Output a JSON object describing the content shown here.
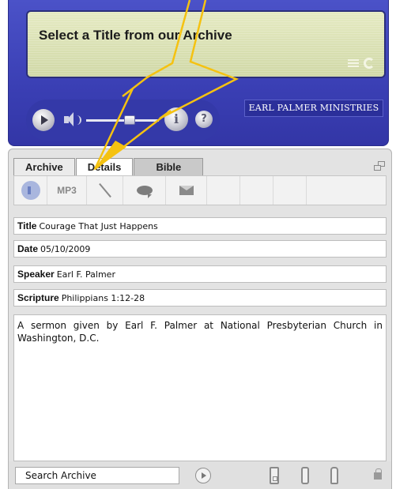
{
  "player": {
    "display_title": "Select a Title from our Archive",
    "brand": "EARL PALMER MINISTRIES",
    "volume_level": 0.6,
    "info_label": "i",
    "help_label": "?"
  },
  "tabs": [
    {
      "label": "Archive"
    },
    {
      "label": "Details"
    },
    {
      "label": "Bible"
    }
  ],
  "toolbar": {
    "mp3_label": "MP3"
  },
  "details": {
    "title_label": "Title",
    "title_value": "Courage That Just Happens",
    "date_label": "Date",
    "date_value": "05/10/2009",
    "speaker_label": "Speaker",
    "speaker_value": "Earl F. Palmer",
    "scripture_label": "Scripture",
    "scripture_value": "Philippians 1:12-28",
    "description": "A sermon given by Earl F. Palmer at National Presbyterian Church in Washington, D.C."
  },
  "search": {
    "placeholder": "Search Archive"
  },
  "colors": {
    "player_blue": "#3a3fb4",
    "display_bg": "#d8dfb0",
    "annotation_arrow": "#f5c211"
  },
  "icons": [
    "list-icon",
    "refresh-icon",
    "play-icon",
    "volume-icon",
    "info-icon",
    "help-icon",
    "restore-icon",
    "speaker-icon",
    "pen-icon",
    "chat-icon",
    "mail-icon",
    "go-icon",
    "device-icon",
    "lock-icon"
  ]
}
